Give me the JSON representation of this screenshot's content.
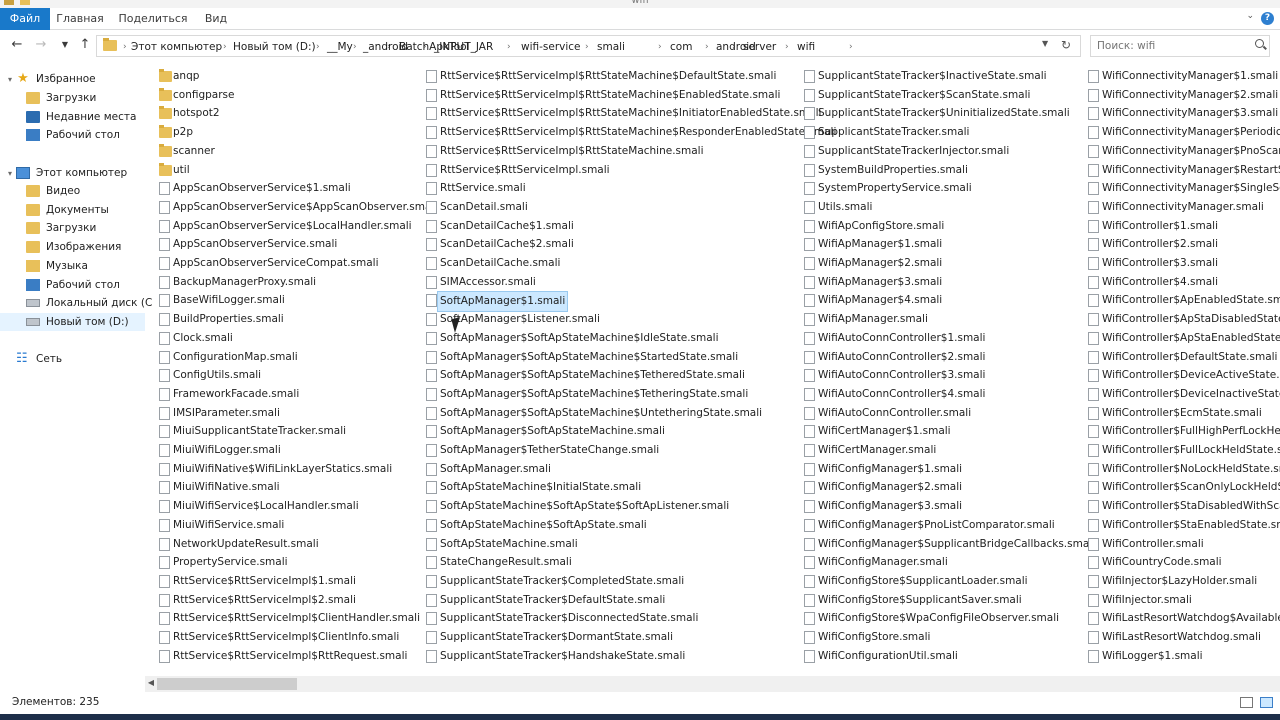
{
  "window": {
    "title": "wifi"
  },
  "ribbon": {
    "tabs": [
      "Файл",
      "Главная",
      "Поделиться",
      "Вид"
    ]
  },
  "address": {
    "crumbs": [
      "Этот компьютер",
      "Новый том (D:)",
      "__My",
      "_android",
      "BatchApkTool",
      "_INPUT_JAR",
      "wifi-service",
      "smali",
      "com",
      "android",
      "server",
      "wifi"
    ]
  },
  "search": {
    "placeholder": "Поиск: wifi"
  },
  "nav": {
    "favorites": "Избранное",
    "fav_items": [
      "Загрузки",
      "Недавние места",
      "Рабочий стол"
    ],
    "computer": "Этот компьютер",
    "pc_items": [
      "Видео",
      "Документы",
      "Загрузки",
      "Изображения",
      "Музыка",
      "Рабочий стол",
      "Локальный диск (C",
      "Новый том (D:)"
    ],
    "network": "Сеть"
  },
  "files": {
    "col1": [
      {
        "n": "anqp",
        "t": "folder"
      },
      {
        "n": "configparse",
        "t": "folder"
      },
      {
        "n": "hotspot2",
        "t": "folder"
      },
      {
        "n": "p2p",
        "t": "folder"
      },
      {
        "n": "scanner",
        "t": "folder"
      },
      {
        "n": "util",
        "t": "folder"
      },
      {
        "n": "AppScanObserverService$1.smali"
      },
      {
        "n": "AppScanObserverService$AppScanObserver.smali"
      },
      {
        "n": "AppScanObserverService$LocalHandler.smali"
      },
      {
        "n": "AppScanObserverService.smali"
      },
      {
        "n": "AppScanObserverServiceCompat.smali"
      },
      {
        "n": "BackupManagerProxy.smali"
      },
      {
        "n": "BaseWifiLogger.smali"
      },
      {
        "n": "BuildProperties.smali"
      },
      {
        "n": "Clock.smali"
      },
      {
        "n": "ConfigurationMap.smali"
      },
      {
        "n": "ConfigUtils.smali"
      },
      {
        "n": "FrameworkFacade.smali"
      },
      {
        "n": "IMSIParameter.smali"
      },
      {
        "n": "MiuiSupplicantStateTracker.smali"
      },
      {
        "n": "MiuiWifiLogger.smali"
      },
      {
        "n": "MiuiWifiNative$WifiLinkLayerStatics.smali"
      },
      {
        "n": "MiuiWifiNative.smali"
      },
      {
        "n": "MiuiWifiService$LocalHandler.smali"
      },
      {
        "n": "MiuiWifiService.smali"
      },
      {
        "n": "NetworkUpdateResult.smali"
      },
      {
        "n": "PropertyService.smali"
      },
      {
        "n": "RttService$RttServiceImpl$1.smali"
      },
      {
        "n": "RttService$RttServiceImpl$2.smali"
      },
      {
        "n": "RttService$RttServiceImpl$ClientHandler.smali"
      },
      {
        "n": "RttService$RttServiceImpl$ClientInfo.smali"
      },
      {
        "n": "RttService$RttServiceImpl$RttRequest.smali"
      }
    ],
    "col2": [
      {
        "n": "RttService$RttServiceImpl$RttStateMachine$DefaultState.smali"
      },
      {
        "n": "RttService$RttServiceImpl$RttStateMachine$EnabledState.smali"
      },
      {
        "n": "RttService$RttServiceImpl$RttStateMachine$InitiatorEnabledState.smali"
      },
      {
        "n": "RttService$RttServiceImpl$RttStateMachine$ResponderEnabledState.smali"
      },
      {
        "n": "RttService$RttServiceImpl$RttStateMachine.smali"
      },
      {
        "n": "RttService$RttServiceImpl.smali"
      },
      {
        "n": "RttService.smali"
      },
      {
        "n": "ScanDetail.smali"
      },
      {
        "n": "ScanDetailCache$1.smali"
      },
      {
        "n": "ScanDetailCache$2.smali"
      },
      {
        "n": "ScanDetailCache.smali"
      },
      {
        "n": "SIMAccessor.smali"
      },
      {
        "n": "SoftApManager$1.smali",
        "sel": true
      },
      {
        "n": "SoftApManager$Listener.smali"
      },
      {
        "n": "SoftApManager$SoftApStateMachine$IdleState.smali"
      },
      {
        "n": "SoftApManager$SoftApStateMachine$StartedState.smali"
      },
      {
        "n": "SoftApManager$SoftApStateMachine$TetheredState.smali"
      },
      {
        "n": "SoftApManager$SoftApStateMachine$TetheringState.smali"
      },
      {
        "n": "SoftApManager$SoftApStateMachine$UntetheringState.smali"
      },
      {
        "n": "SoftApManager$SoftApStateMachine.smali"
      },
      {
        "n": "SoftApManager$TetherStateChange.smali"
      },
      {
        "n": "SoftApManager.smali"
      },
      {
        "n": "SoftApStateMachine$InitialState.smali"
      },
      {
        "n": "SoftApStateMachine$SoftApState$SoftApListener.smali"
      },
      {
        "n": "SoftApStateMachine$SoftApState.smali"
      },
      {
        "n": "SoftApStateMachine.smali"
      },
      {
        "n": "StateChangeResult.smali"
      },
      {
        "n": "SupplicantStateTracker$CompletedState.smali"
      },
      {
        "n": "SupplicantStateTracker$DefaultState.smali"
      },
      {
        "n": "SupplicantStateTracker$DisconnectedState.smali"
      },
      {
        "n": "SupplicantStateTracker$DormantState.smali"
      },
      {
        "n": "SupplicantStateTracker$HandshakeState.smali"
      }
    ],
    "col3": [
      {
        "n": "SupplicantStateTracker$InactiveState.smali"
      },
      {
        "n": "SupplicantStateTracker$ScanState.smali"
      },
      {
        "n": "SupplicantStateTracker$UninitializedState.smali"
      },
      {
        "n": "SupplicantStateTracker.smali"
      },
      {
        "n": "SupplicantStateTrackerInjector.smali"
      },
      {
        "n": "SystemBuildProperties.smali"
      },
      {
        "n": "SystemPropertyService.smali"
      },
      {
        "n": "Utils.smali"
      },
      {
        "n": "WifiApConfigStore.smali"
      },
      {
        "n": "WifiApManager$1.smali"
      },
      {
        "n": "WifiApManager$2.smali"
      },
      {
        "n": "WifiApManager$3.smali"
      },
      {
        "n": "WifiApManager$4.smali"
      },
      {
        "n": "WifiApManager.smali"
      },
      {
        "n": "WifiAutoConnController$1.smali"
      },
      {
        "n": "WifiAutoConnController$2.smali"
      },
      {
        "n": "WifiAutoConnController$3.smali"
      },
      {
        "n": "WifiAutoConnController$4.smali"
      },
      {
        "n": "WifiAutoConnController.smali"
      },
      {
        "n": "WifiCertManager$1.smali"
      },
      {
        "n": "WifiCertManager.smali"
      },
      {
        "n": "WifiConfigManager$1.smali"
      },
      {
        "n": "WifiConfigManager$2.smali"
      },
      {
        "n": "WifiConfigManager$3.smali"
      },
      {
        "n": "WifiConfigManager$PnoListComparator.smali"
      },
      {
        "n": "WifiConfigManager$SupplicantBridgeCallbacks.smali"
      },
      {
        "n": "WifiConfigManager.smali"
      },
      {
        "n": "WifiConfigStore$SupplicantLoader.smali"
      },
      {
        "n": "WifiConfigStore$SupplicantSaver.smali"
      },
      {
        "n": "WifiConfigStore$WpaConfigFileObserver.smali"
      },
      {
        "n": "WifiConfigStore.smali"
      },
      {
        "n": "WifiConfigurationUtil.smali"
      }
    ],
    "col4": [
      {
        "n": "WifiConnectivityManager$1.smali"
      },
      {
        "n": "WifiConnectivityManager$2.smali"
      },
      {
        "n": "WifiConnectivityManager$3.smali"
      },
      {
        "n": "WifiConnectivityManager$PeriodicScanListener.smali"
      },
      {
        "n": "WifiConnectivityManager$PnoScanListener.smali"
      },
      {
        "n": "WifiConnectivityManager$RestartSingleScanListener.smali"
      },
      {
        "n": "WifiConnectivityManager$SingleScanListener.smali"
      },
      {
        "n": "WifiConnectivityManager.smali"
      },
      {
        "n": "WifiController$1.smali"
      },
      {
        "n": "WifiController$2.smali"
      },
      {
        "n": "WifiController$3.smali"
      },
      {
        "n": "WifiController$4.smali"
      },
      {
        "n": "WifiController$ApEnabledState.smali"
      },
      {
        "n": "WifiController$ApStaDisabledState.smali"
      },
      {
        "n": "WifiController$ApStaEnabledState.smali"
      },
      {
        "n": "WifiController$DefaultState.smali"
      },
      {
        "n": "WifiController$DeviceActiveState.smali"
      },
      {
        "n": "WifiController$DeviceInactiveState.smali"
      },
      {
        "n": "WifiController$EcmState.smali"
      },
      {
        "n": "WifiController$FullHighPerfLockHeldState.smali"
      },
      {
        "n": "WifiController$FullLockHeldState.smali"
      },
      {
        "n": "WifiController$NoLockHeldState.smali"
      },
      {
        "n": "WifiController$ScanOnlyLockHeldState.smali"
      },
      {
        "n": "WifiController$StaDisabledWithScanState.smali"
      },
      {
        "n": "WifiController$StaEnabledState.smali"
      },
      {
        "n": "WifiController.smali"
      },
      {
        "n": "WifiCountryCode.smali"
      },
      {
        "n": "WifiInjector$LazyHolder.smali"
      },
      {
        "n": "WifiInjector.smali"
      },
      {
        "n": "WifiLastResortWatchdog$AvailableNetworkFailureCount.smali"
      },
      {
        "n": "WifiLastResortWatchdog.smali"
      },
      {
        "n": "WifiLogger$1.smali"
      }
    ]
  },
  "status": {
    "count": "Элементов: 235"
  }
}
